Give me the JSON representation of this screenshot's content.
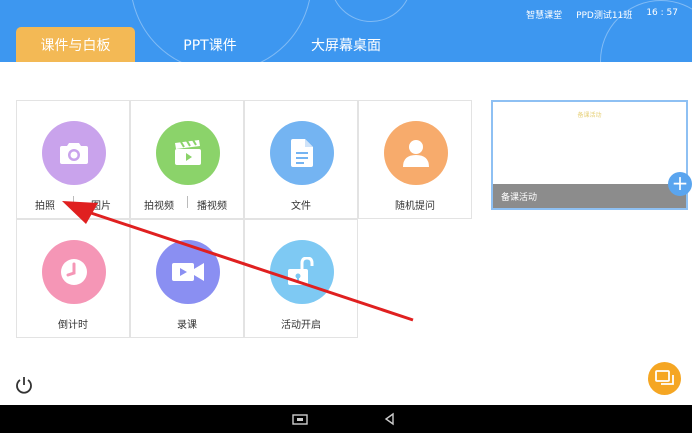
{
  "status": {
    "classroom": "智慧课堂",
    "class_name": "PPD测试11班",
    "time": "16 : 57"
  },
  "tabs": [
    {
      "label": "课件与白板",
      "active": true
    },
    {
      "label": "PPT课件",
      "active": false
    },
    {
      "label": "大屏幕桌面",
      "active": false
    }
  ],
  "tools": {
    "photo": {
      "label": "拍照",
      "color": "#c9a3ec",
      "icon": "camera-icon"
    },
    "picture": {
      "label": "图片"
    },
    "record_video": {
      "label": "拍视频",
      "color": "#8bd36a",
      "icon": "clapperboard-icon"
    },
    "play_video": {
      "label": "播视频"
    },
    "file": {
      "label": "文件",
      "color": "#74b4f2",
      "icon": "document-icon"
    },
    "random_question": {
      "label": "随机提问",
      "color": "#f7ab6c",
      "icon": "person-icon"
    },
    "countdown": {
      "label": "倒计时",
      "color": "#f596b6",
      "icon": "clock-icon"
    },
    "record_lesson": {
      "label": "录课",
      "color": "#8a8ff2",
      "icon": "video-camera-icon"
    },
    "start_activity": {
      "label": "活动开启",
      "color": "#7ec9f3",
      "icon": "unlock-icon"
    }
  },
  "activity_card": {
    "title": "备课活动",
    "label": "备课活动",
    "plus": "+"
  },
  "colors": {
    "topbar": "#3d97f0",
    "active_tab": "#f3b955",
    "annotation_arrow": "#e02020",
    "chat_button": "#f5a623"
  },
  "icons": {
    "power": "power-icon",
    "chat": "chat-bubbles-icon",
    "nav_recent": "recent-apps-icon",
    "nav_back": "back-triangle-icon"
  }
}
